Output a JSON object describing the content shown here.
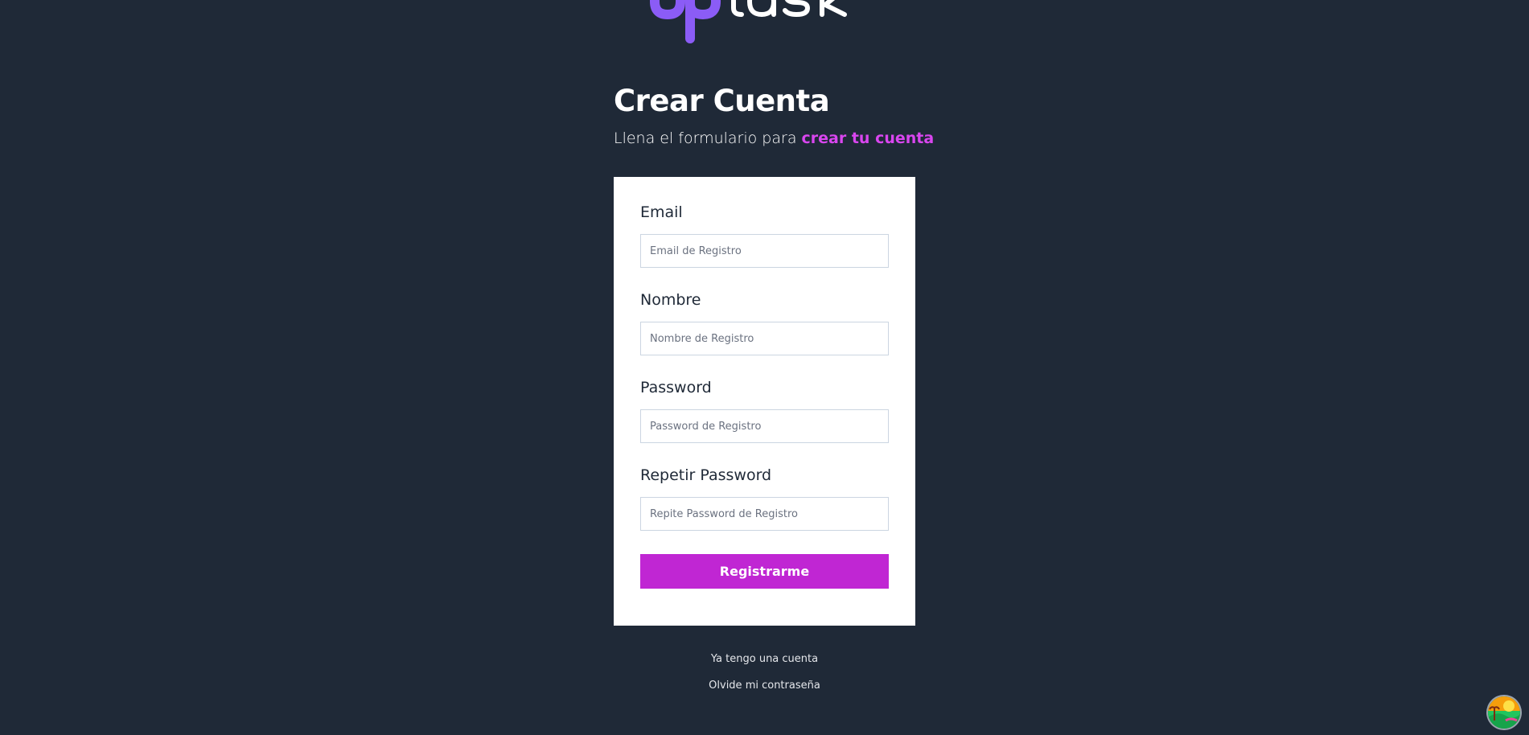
{
  "logo": {
    "text": "uptask",
    "icon": "uptask-logo-icon"
  },
  "header": {
    "title": "Crear Cuenta",
    "subtitle_prefix": "Llena el formulario para ",
    "subtitle_accent": "crear tu cuenta"
  },
  "form": {
    "email": {
      "label": "Email",
      "placeholder": "Email de Registro",
      "value": ""
    },
    "nombre": {
      "label": "Nombre",
      "placeholder": "Nombre de Registro",
      "value": ""
    },
    "password": {
      "label": "Password",
      "placeholder": "Password de Registro",
      "value": ""
    },
    "repeat_password": {
      "label": "Repetir Password",
      "placeholder": "Repite Password de Registro",
      "value": ""
    },
    "submit_label": "Registrarme"
  },
  "links": {
    "login": "Ya tengo una cuenta",
    "forgot": "Olvide mi contraseña"
  },
  "colors": {
    "background": "#1f2937",
    "accent": "#d946ef",
    "button": "#c026d3",
    "logo_primary": "#8b5cf6",
    "logo_secondary": "#ffffff"
  },
  "fab": {
    "icon": "extension-avatar-icon"
  }
}
